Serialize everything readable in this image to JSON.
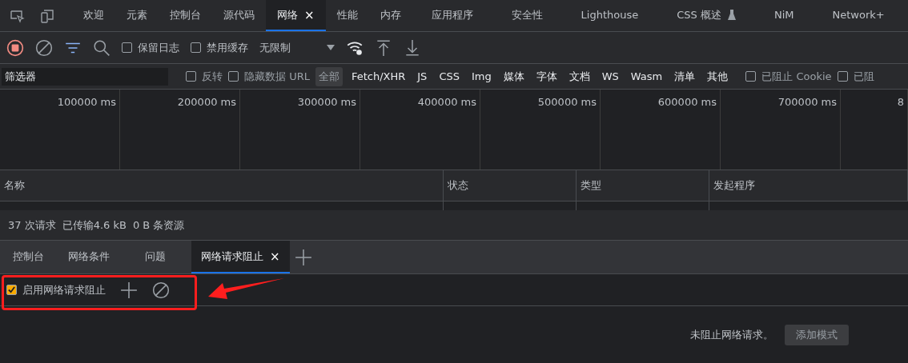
{
  "main_tabs": [
    {
      "label": "欢迎",
      "selected": false
    },
    {
      "label": "元素",
      "selected": false
    },
    {
      "label": "控制台",
      "selected": false
    },
    {
      "label": "源代码",
      "selected": false
    },
    {
      "label": "网络",
      "selected": true,
      "close": "×"
    },
    {
      "label": "性能",
      "selected": false
    },
    {
      "label": "内存",
      "selected": false
    },
    {
      "label": "应用程序",
      "selected": false
    },
    {
      "label": "安全性",
      "selected": false
    },
    {
      "label": "Lighthouse",
      "selected": false
    },
    {
      "label": "CSS 概述",
      "selected": false,
      "experimental": true
    },
    {
      "label": "NiM",
      "selected": false
    },
    {
      "label": "Network+",
      "selected": false
    }
  ],
  "toolbar": {
    "recording": true,
    "checkboxes": [
      {
        "label": "保留日志",
        "checked": false
      },
      {
        "label": "禁用缓存",
        "checked": false
      }
    ],
    "throttling": "无限制"
  },
  "filter_bar": {
    "placeholder": "筛选器",
    "checkboxes": [
      {
        "label": "反转",
        "checked": false
      },
      {
        "label": "隐藏数据 URL",
        "checked": false
      }
    ],
    "types": [
      {
        "label": "全部",
        "selected": true
      },
      {
        "label": "Fetch/XHR",
        "selected": false
      },
      {
        "label": "JS",
        "selected": false
      },
      {
        "label": "CSS",
        "selected": false
      },
      {
        "label": "Img",
        "selected": false
      },
      {
        "label": "媒体",
        "selected": false
      },
      {
        "label": "字体",
        "selected": false
      },
      {
        "label": "文档",
        "selected": false
      },
      {
        "label": "WS",
        "selected": false
      },
      {
        "label": "Wasm",
        "selected": false
      },
      {
        "label": "清单",
        "selected": false
      },
      {
        "label": "其他",
        "selected": false
      }
    ],
    "trailing_checkboxes": [
      {
        "label": "已阻止 Cookie",
        "checked": false
      },
      {
        "label": "已阻",
        "checked": false
      }
    ]
  },
  "overview": {
    "ticks": [
      "100000 ms",
      "200000 ms",
      "300000 ms",
      "400000 ms",
      "500000 ms",
      "600000 ms",
      "700000 ms",
      "8"
    ]
  },
  "table": {
    "columns": [
      "名称",
      "状态",
      "类型",
      "发起程序"
    ]
  },
  "summary": [
    "37 次请求",
    "已传输4.6 kB",
    "0 B 条资源"
  ],
  "drawer_tabs": [
    {
      "label": "控制台",
      "selected": false
    },
    {
      "label": "网络条件",
      "selected": false
    },
    {
      "label": "问题",
      "selected": false
    },
    {
      "label": "网络请求阻止",
      "selected": true,
      "close": "×"
    }
  ],
  "blocking": {
    "label": "启用网络请求阻止",
    "checked": true,
    "empty_message": "未阻止网络请求。",
    "add_button": "添加模式"
  }
}
